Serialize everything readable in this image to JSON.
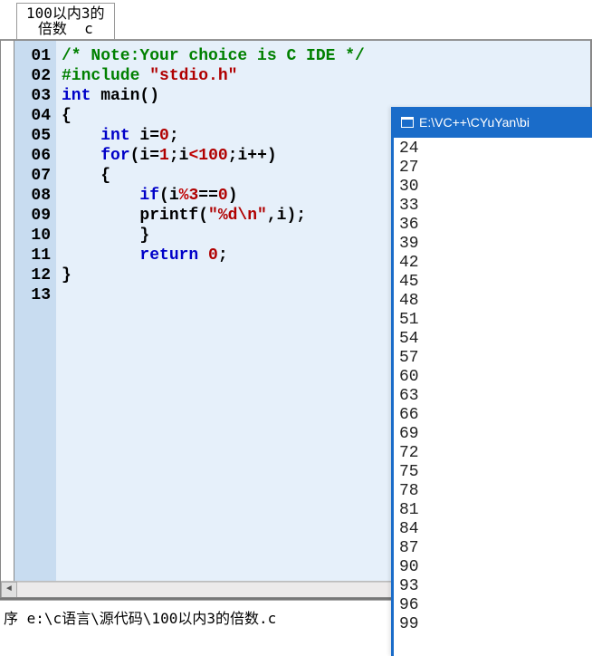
{
  "tab": {
    "label": "100以内3的\n倍数  c"
  },
  "gutter": [
    "01",
    "02",
    "03",
    "04",
    "05",
    "06",
    "07",
    "08",
    "09",
    "10",
    "11",
    "12",
    "13"
  ],
  "code": {
    "l1_comment": "/* Note:Your choice is C IDE */",
    "l2_include": "#include ",
    "l2_header": "\"stdio.h\"",
    "l3_int": "int",
    "l3_main": " main()",
    "l4": "{",
    "l5_pad": "    ",
    "l5_int": "int",
    "l5_rest1": " i=",
    "l5_zero": "0",
    "l5_semi": ";",
    "l6_pad": "    ",
    "l6_for": "for",
    "l6_open": "(i=",
    "l6_one": "1",
    "l6_semi1": ";i",
    "l6_lt": "<",
    "l6_hund": "100",
    "l6_semi2": ";i++)",
    "l7": "    {",
    "l8_pad": "        ",
    "l8_if": "if",
    "l8_open": "(i",
    "l8_mod": "%",
    "l8_three": "3",
    "l8_eq": "==",
    "l8_zero": "0",
    "l8_close": ")",
    "l9": "",
    "l10_pad": "        printf(",
    "l10_str": "\"%d\\n\"",
    "l10_rest": ",i);",
    "l11": "        }",
    "l12_pad": "        ",
    "l12_return": "return",
    "l12_sp": " ",
    "l12_zero": "0",
    "l12_semi": ";",
    "l13": "}"
  },
  "console": {
    "title": "E:\\VC++\\CYuYan\\bi",
    "output": [
      "24",
      "27",
      "30",
      "33",
      "36",
      "39",
      "42",
      "45",
      "48",
      "51",
      "54",
      "57",
      "60",
      "63",
      "66",
      "69",
      "72",
      "75",
      "78",
      "81",
      "84",
      "87",
      "90",
      "93",
      "96",
      "99"
    ]
  },
  "footer": {
    "path": "序 e:\\c语言\\源代码\\100以内3的倍数.c"
  }
}
